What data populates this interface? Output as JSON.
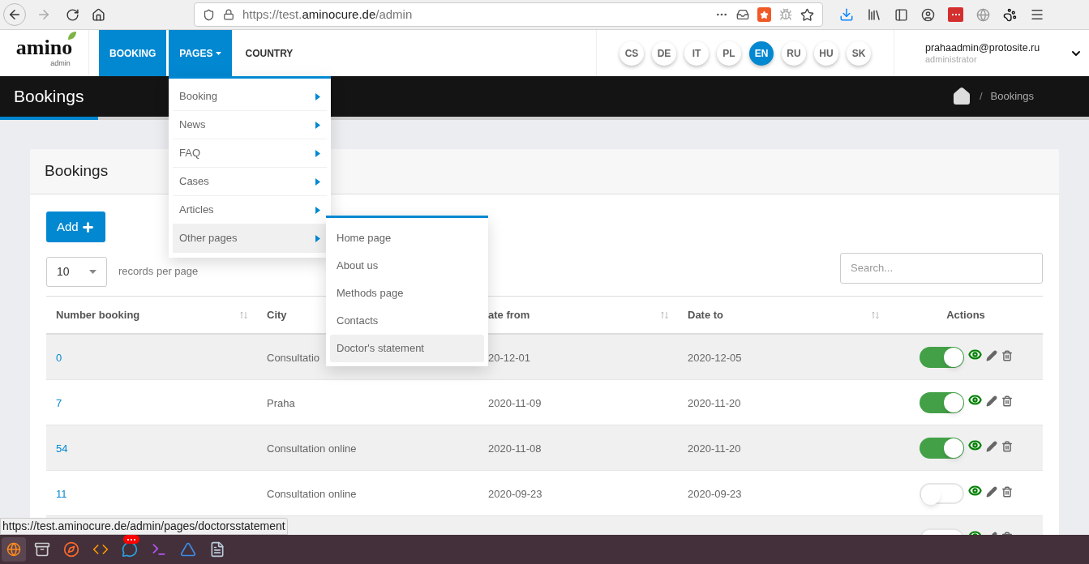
{
  "browser": {
    "url_scheme": "https://test.",
    "url_domain": "aminocure.de",
    "url_path": "/admin"
  },
  "logo": {
    "name": "amino",
    "sub": "admin"
  },
  "menu": [
    {
      "label": "BOOKING",
      "selected": true,
      "caret": false
    },
    {
      "label": "PAGES",
      "selected": true,
      "caret": true
    },
    {
      "label": "COUNTRY",
      "selected": false,
      "caret": false
    }
  ],
  "languages": [
    {
      "code": "CS",
      "selected": false
    },
    {
      "code": "DE",
      "selected": false
    },
    {
      "code": "IT",
      "selected": false
    },
    {
      "code": "PL",
      "selected": false
    },
    {
      "code": "EN",
      "selected": true
    },
    {
      "code": "RU",
      "selected": false
    },
    {
      "code": "HU",
      "selected": false
    },
    {
      "code": "SK",
      "selected": false
    }
  ],
  "user": {
    "email": "prahaadmin@protosite.ru",
    "role": "administrator"
  },
  "header": {
    "title": "Bookings",
    "separator": "/",
    "breadcrumb": "Bookings"
  },
  "dropdown": [
    {
      "label": "Booking",
      "selected": false
    },
    {
      "label": "News",
      "selected": false
    },
    {
      "label": "FAQ",
      "selected": false
    },
    {
      "label": "Cases",
      "selected": false
    },
    {
      "label": "Articles",
      "selected": false
    },
    {
      "label": "Other pages",
      "selected": true
    }
  ],
  "submenu": [
    {
      "label": "Home page",
      "selected": false
    },
    {
      "label": "About us",
      "selected": false
    },
    {
      "label": "Methods page",
      "selected": false
    },
    {
      "label": "Contacts",
      "selected": false
    },
    {
      "label": "Doctor's statement",
      "selected": true
    }
  ],
  "card": {
    "title": "Bookings",
    "add_button": "Add",
    "page_size": "10",
    "page_size_label": "records per page",
    "search": {
      "placeholder": "Search..."
    }
  },
  "columns": [
    {
      "label": "Number booking",
      "sortable": true
    },
    {
      "label": "City"
    },
    {
      "label": "ate from",
      "sortable": true
    },
    {
      "label": "Date to",
      "sortable": true
    },
    {
      "label": "Actions",
      "sortable": false
    }
  ],
  "rows": [
    {
      "number": "0",
      "city": "Consultatio",
      "date_from": "20-12-01",
      "date_to": "2020-12-05",
      "on": true
    },
    {
      "number": "7",
      "city": "Praha",
      "date_from": "2020-11-09",
      "date_to": "2020-11-20",
      "on": true
    },
    {
      "number": "54",
      "city": "Consultation online",
      "date_from": "2020-11-08",
      "date_to": "2020-11-20",
      "on": true
    },
    {
      "number": "11",
      "city": "Consultation online",
      "date_from": "2020-09-23",
      "date_to": "2020-09-23",
      "on": false
    },
    {
      "on": false
    }
  ],
  "status_url": "https://test.aminocure.de/admin/pages/doctorsstatement"
}
